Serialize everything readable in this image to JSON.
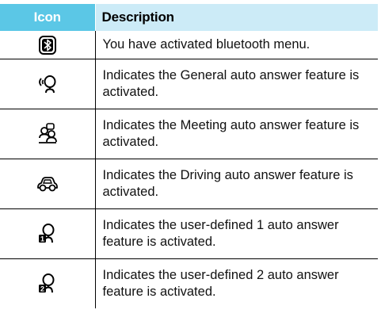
{
  "table": {
    "headers": {
      "icon": "Icon",
      "description": "Description"
    },
    "rows": [
      {
        "icon": "bluetooth-icon",
        "description": "You have activated bluetooth menu."
      },
      {
        "icon": "general-auto-answer-icon",
        "description": "Indicates the General auto answer feature is activated."
      },
      {
        "icon": "meeting-auto-answer-icon",
        "description": "Indicates the Meeting auto answer feature is activated."
      },
      {
        "icon": "driving-auto-answer-icon",
        "description": "Indicates the Driving auto answer feature is activated."
      },
      {
        "icon": "user-defined-1-auto-answer-icon",
        "description": "Indicates the user-defined 1 auto answer feature is activated.",
        "badge": "1"
      },
      {
        "icon": "user-defined-2-auto-answer-icon",
        "description": "Indicates the user-defined 2 auto answer feature is activated.",
        "badge": "2"
      }
    ]
  },
  "colors": {
    "header_icon_bg": "#5bc7e6",
    "header_desc_bg": "#ccebf7",
    "rule": "#000000"
  }
}
